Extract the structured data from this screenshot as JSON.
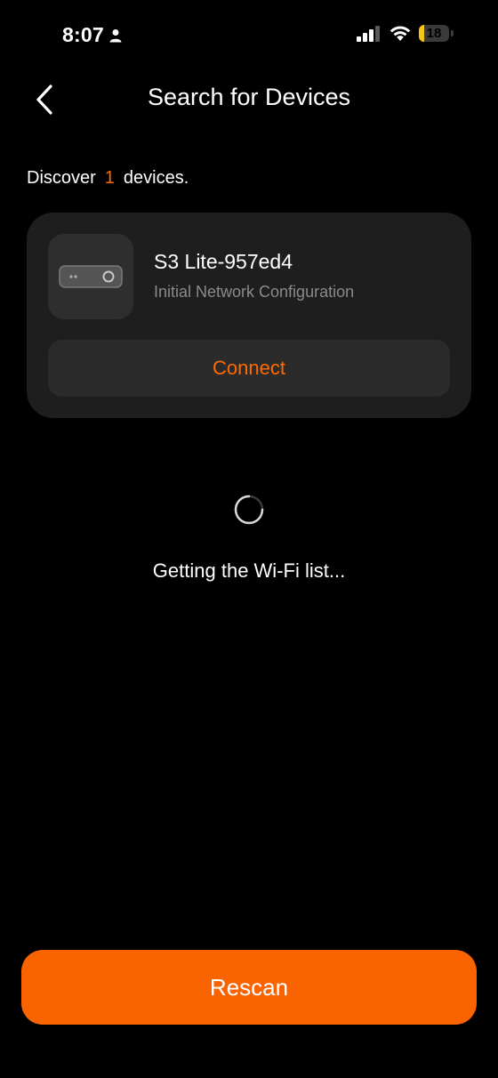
{
  "status_bar": {
    "time": "8:07",
    "battery_level": "18",
    "battery_fraction": 0.18
  },
  "header": {
    "title": "Search for Devices"
  },
  "discover": {
    "prefix": "Discover",
    "count": "1",
    "suffix": "devices."
  },
  "devices": [
    {
      "name": "S3 Lite-957ed4",
      "status": "Initial Network Configuration",
      "action_label": "Connect"
    }
  ],
  "loading": {
    "text": "Getting the Wi-Fi list..."
  },
  "footer": {
    "rescan_label": "Rescan"
  },
  "colors": {
    "accent": "#fa6400",
    "accent_text": "#ff6a00",
    "card_bg": "#1e1e1e",
    "background": "#000000"
  }
}
